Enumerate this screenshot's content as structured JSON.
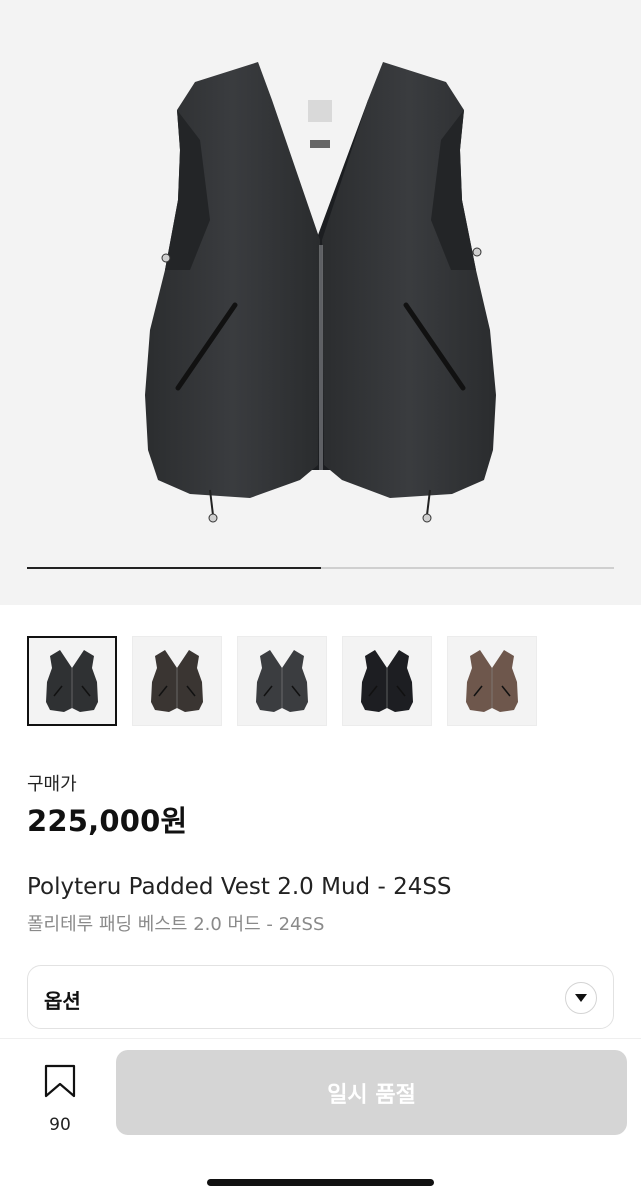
{
  "product_image": {
    "alt": "vest",
    "slide_progress": 0.5
  },
  "thumbnails": [
    {
      "color_name": "charcoal",
      "color": "#2f3133",
      "selected": true
    },
    {
      "color_name": "dark brown",
      "color": "#3a3532",
      "selected": false
    },
    {
      "color_name": "graphite",
      "color": "#3b3d40",
      "selected": false
    },
    {
      "color_name": "black",
      "color": "#1d1e22",
      "selected": false
    },
    {
      "color_name": "mud",
      "color": "#6e574c",
      "selected": false
    }
  ],
  "price": {
    "label": "구매가",
    "value": "225,000원"
  },
  "product": {
    "title_en": "Polyteru Padded Vest 2.0 Mud - 24SS",
    "title_ko": "폴리테루 패딩 베스트 2.0 머드 - 24SS"
  },
  "option": {
    "label": "옵션"
  },
  "bottom_bar": {
    "wish_count": "90",
    "soldout_label": "일시 품절"
  },
  "colors": {
    "hero_bg": "#f3f3f3",
    "button_disabled": "#d5d5d5",
    "text_secondary": "#8a8a8a"
  }
}
